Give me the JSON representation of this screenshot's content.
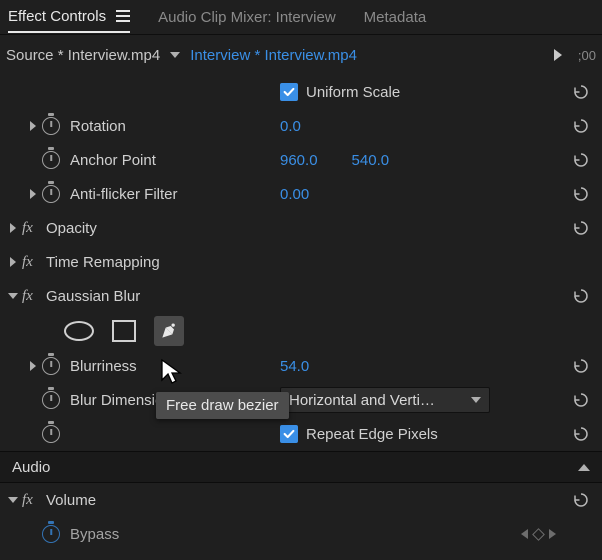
{
  "tabs": {
    "effect_controls": "Effect Controls",
    "audio_mixer": "Audio Clip Mixer: Interview",
    "metadata": "Metadata"
  },
  "source": {
    "label": "Source * Interview.mp4",
    "clip": "Interview * Interview.mp4",
    "timecode": ";00"
  },
  "props": {
    "uniform_scale": {
      "label": "Uniform Scale",
      "checked": true
    },
    "rotation": {
      "label": "Rotation",
      "value": "0.0"
    },
    "anchor": {
      "label": "Anchor Point",
      "x": "960.0",
      "y": "540.0"
    },
    "antiflicker": {
      "label": "Anti-flicker Filter",
      "value": "0.00"
    },
    "opacity": {
      "label": "Opacity"
    },
    "time_remap": {
      "label": "Time Remapping"
    },
    "gaussian": {
      "label": "Gaussian Blur"
    },
    "blurriness": {
      "label": "Blurriness",
      "value": "54.0"
    },
    "blur_dims": {
      "label": "Blur Dimensions",
      "value": "Horizontal and Verti…"
    },
    "repeat_edge": {
      "label": "Repeat Edge Pixels",
      "checked": true
    }
  },
  "tooltip": "Free draw bezier",
  "audio": {
    "header": "Audio",
    "volume": "Volume",
    "bypass": "Bypass"
  },
  "icons": {
    "ellipse": "ellipse-mask",
    "rect": "rect-mask",
    "pen": "pen-mask"
  }
}
